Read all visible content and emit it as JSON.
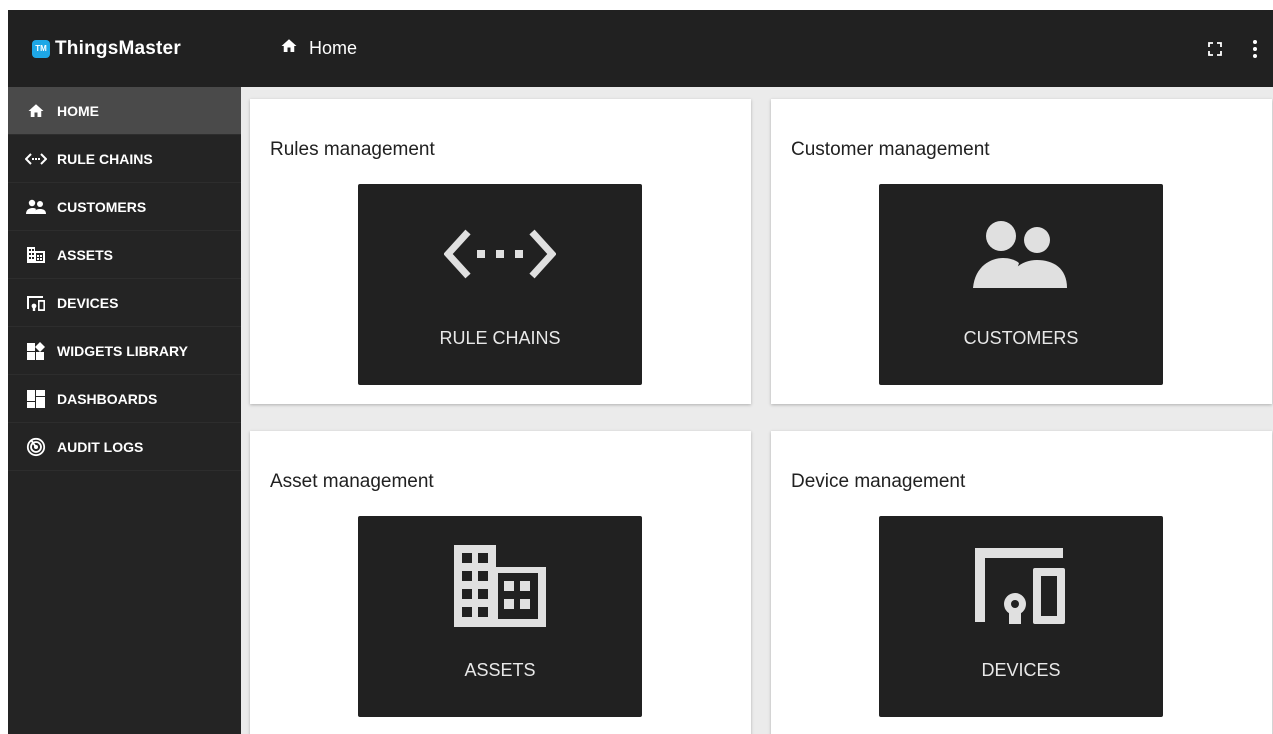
{
  "brand": {
    "badge": "TM",
    "name": "ThingsMaster"
  },
  "sidebar": {
    "items": [
      {
        "label": "HOME",
        "icon": "home-icon",
        "active": true
      },
      {
        "label": "RULE CHAINS",
        "icon": "rule-chains-icon"
      },
      {
        "label": "CUSTOMERS",
        "icon": "customers-icon"
      },
      {
        "label": "ASSETS",
        "icon": "assets-icon"
      },
      {
        "label": "DEVICES",
        "icon": "devices-icon"
      },
      {
        "label": "WIDGETS LIBRARY",
        "icon": "widgets-library-icon"
      },
      {
        "label": "DASHBOARDS",
        "icon": "dashboards-icon"
      },
      {
        "label": "AUDIT LOGS",
        "icon": "audit-logs-icon"
      }
    ]
  },
  "header": {
    "title": "Home",
    "icons": [
      "fullscreen-icon",
      "more-vert-icon"
    ]
  },
  "cards": [
    {
      "title": "Rules management",
      "tile_label": "RULE CHAINS",
      "icon": "rule-chains-icon"
    },
    {
      "title": "Customer management",
      "tile_label": "CUSTOMERS",
      "icon": "customers-icon"
    },
    {
      "title": "Asset management",
      "tile_label": "ASSETS",
      "icon": "assets-icon"
    },
    {
      "title": "Device management",
      "tile_label": "DEVICES",
      "icon": "devices-icon"
    }
  ],
  "colors": {
    "sidebar_bg": "#242424",
    "header_bg": "#212121",
    "active_item_bg": "#4a4a4a",
    "tile_bg": "#212121",
    "content_bg": "#ebebeb",
    "brand_badge": "#1ea7e6"
  }
}
